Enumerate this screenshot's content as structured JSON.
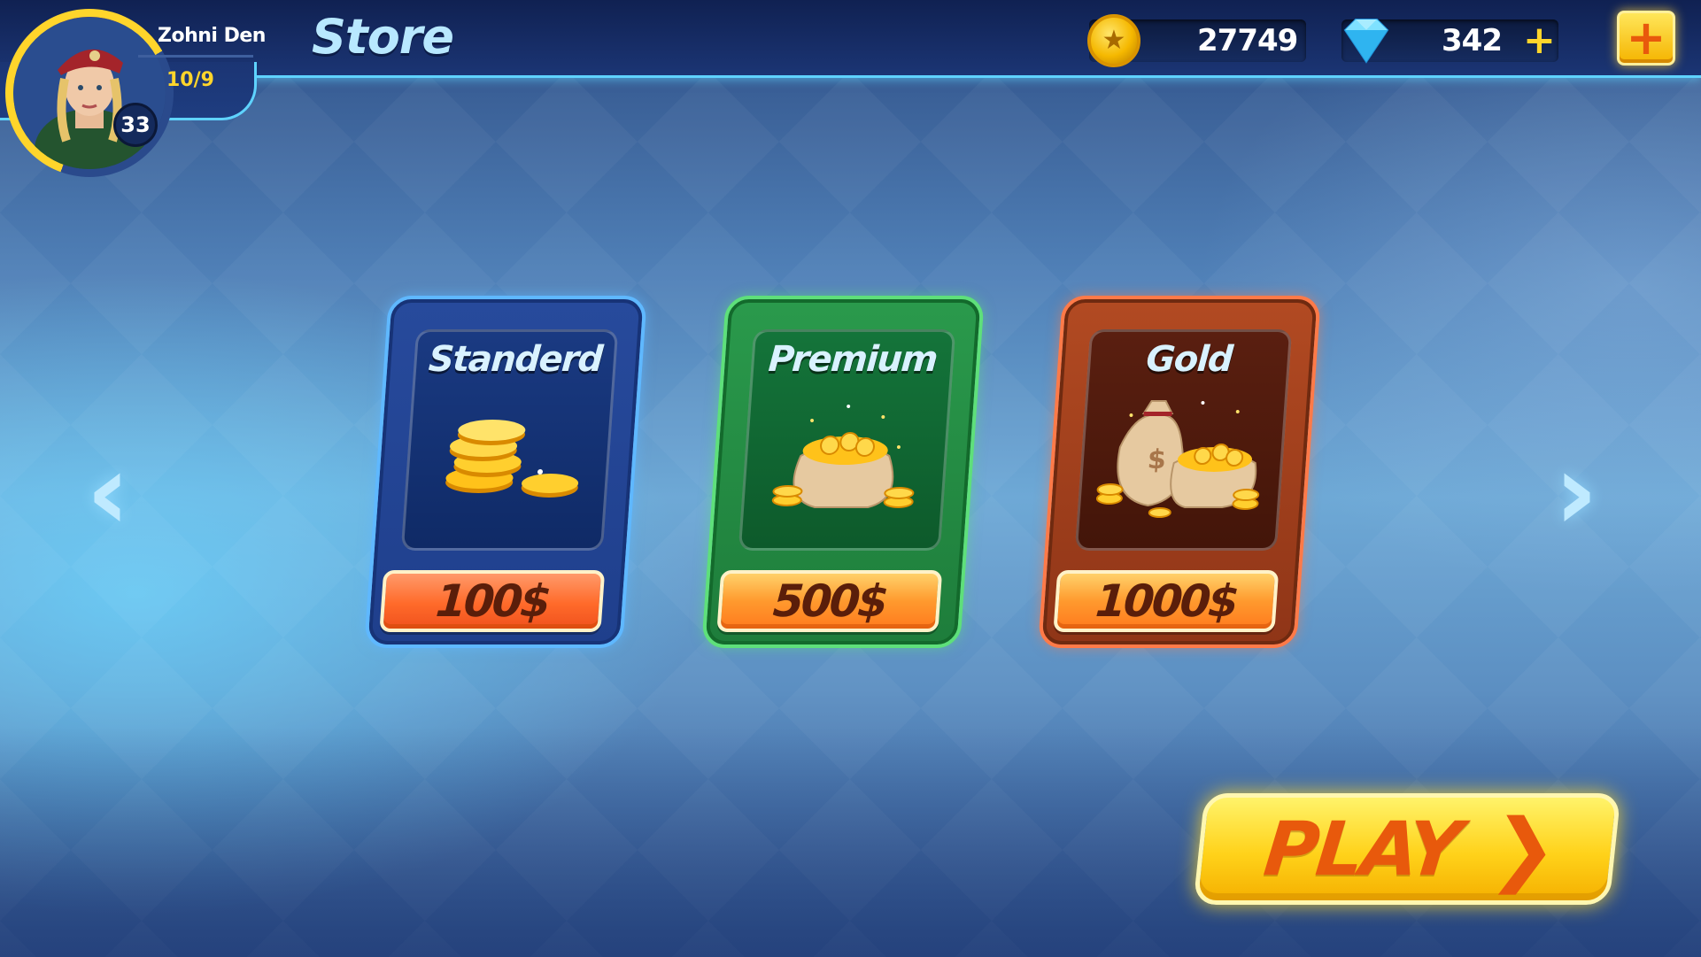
{
  "header": {
    "title": "Store",
    "player": {
      "name": "Zohni Den",
      "progress": "10/9",
      "level": "33"
    },
    "currencies": {
      "coins": "27749",
      "gems": "342",
      "gems_add_icon": "+",
      "shop_add_icon": "+"
    }
  },
  "packs": [
    {
      "title": "Standerd",
      "price": "100$",
      "theme": "blue",
      "art_icon": "coin-stack-icon"
    },
    {
      "title": "Premium",
      "price": "500$",
      "theme": "green",
      "art_icon": "coin-sack-icon"
    },
    {
      "title": "Gold",
      "price": "1000$",
      "theme": "orange",
      "art_icon": "money-bags-icon"
    }
  ],
  "navigation": {
    "prev_icon": "‹",
    "next_icon": "›"
  },
  "play_button": {
    "label": "PLAY",
    "chevron": "❯"
  },
  "colors": {
    "accent_cyan": "#5fd3ff",
    "gold": "#ffd52b",
    "play_text": "#e8590c"
  }
}
